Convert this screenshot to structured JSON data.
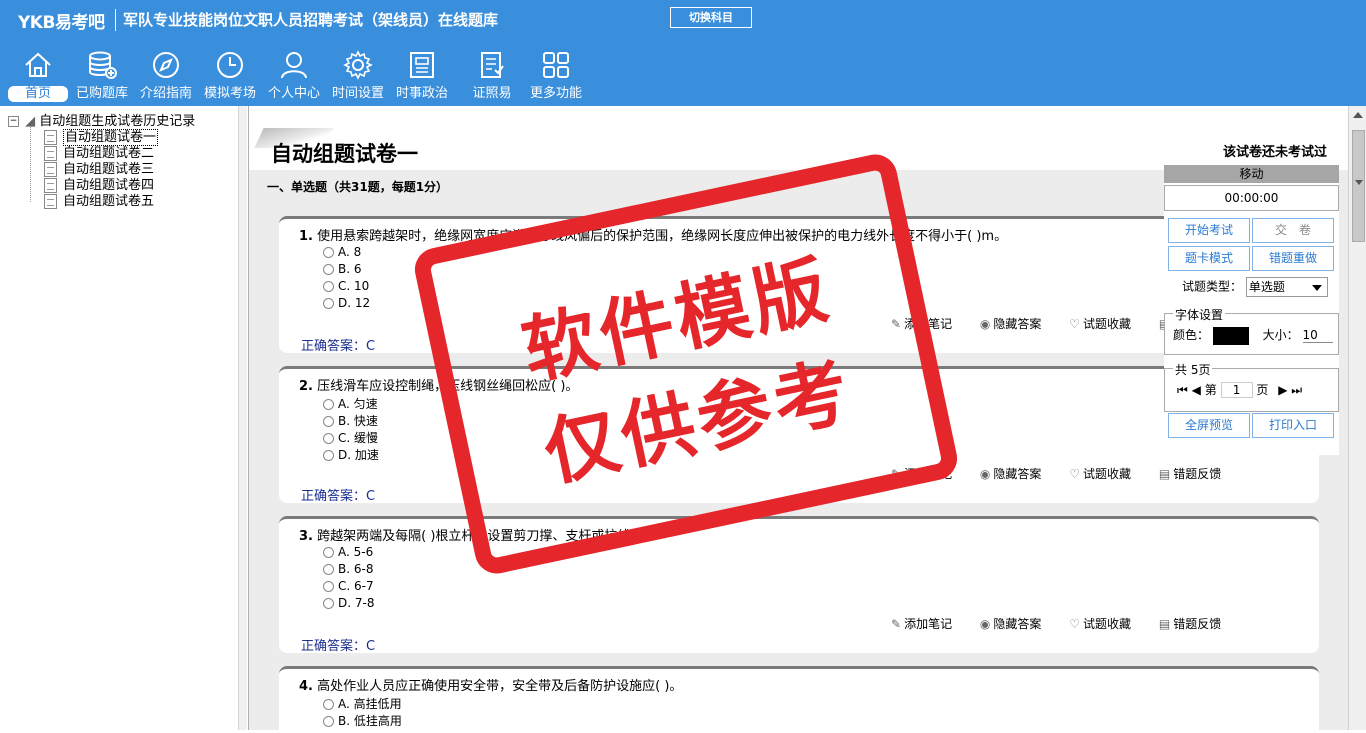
{
  "header": {
    "logo": "YKB易考吧",
    "title": "军队专业技能岗位文职人员招聘考试（架线员）在线题库",
    "switch_label": "切换科目"
  },
  "nav": [
    {
      "label": "首页",
      "icon": "home-icon"
    },
    {
      "label": "已购题库",
      "icon": "database-icon"
    },
    {
      "label": "介绍指南",
      "icon": "compass-icon"
    },
    {
      "label": "模拟考场",
      "icon": "clock-icon"
    },
    {
      "label": "个人中心",
      "icon": "user-icon"
    },
    {
      "label": "时间设置",
      "icon": "gear-icon"
    },
    {
      "label": "时事政治",
      "icon": "news-icon"
    },
    {
      "label": "证照易",
      "icon": "document-icon"
    },
    {
      "label": "更多功能",
      "icon": "grid-icon"
    }
  ],
  "tree": {
    "root": "自动组题生成试卷历史记录",
    "items": [
      "自动组题试卷一",
      "自动组题试卷二",
      "自动组题试卷三",
      "自动组题试卷四",
      "自动组题试卷五"
    ]
  },
  "paper": {
    "title": "自动组题试卷一",
    "status": "该试卷还未考试过",
    "section": "一、单选题（共31题，每题1分）"
  },
  "actions": {
    "note": "添加笔记",
    "hide": "隐藏答案",
    "fav": "试题收藏",
    "report": "错题反馈"
  },
  "answer_label": "正确答案：",
  "questions": [
    {
      "num": "1.",
      "text": "使用悬索跨越架时，绝缘网宽度应满足导线风偏后的保护范围，绝缘网长度应伸出被保护的电力线外长度不得小于( )m。",
      "options": [
        "A. 8",
        "B. 6",
        "C. 10",
        "D. 12"
      ],
      "answer": "C"
    },
    {
      "num": "2.",
      "text": "压线滑车应设控制绳，压线钢丝绳回松应( )。",
      "options": [
        "A. 匀速",
        "B. 快速",
        "C. 缓慢",
        "D. 加速"
      ],
      "answer": "C"
    },
    {
      "num": "3.",
      "text": "跨越架两端及每隔( )根立杆应设置剪刀撑、支杆或拉线。",
      "options": [
        "A. 5-6",
        "B. 6-8",
        "C. 6-7",
        "D. 7-8"
      ],
      "answer": "C"
    },
    {
      "num": "4.",
      "text": "高处作业人员应正确使用安全带，安全带及后备防护设施应( )。",
      "options": [
        "A. 高挂低用",
        "B. 低挂高用"
      ],
      "answer": ""
    }
  ],
  "side": {
    "head": "移动",
    "timer": "00:00:00",
    "start": "开始考试",
    "submit": "交　卷",
    "card": "题卡模式",
    "redo": "错题重做",
    "type_label": "试题类型：",
    "type_value": "单选题",
    "font_legend": "字体设置",
    "color_label": "颜色：",
    "size_label": "大小：",
    "size_value": "10",
    "pages_legend": "共 5页",
    "page_prefix": "第",
    "page_value": "1",
    "page_suffix": "页",
    "fullscreen": "全屏预览",
    "print": "打印入口"
  },
  "stamp": {
    "line1": "软件模版",
    "line2": "仅供参考",
    "color": "#e5262a"
  }
}
